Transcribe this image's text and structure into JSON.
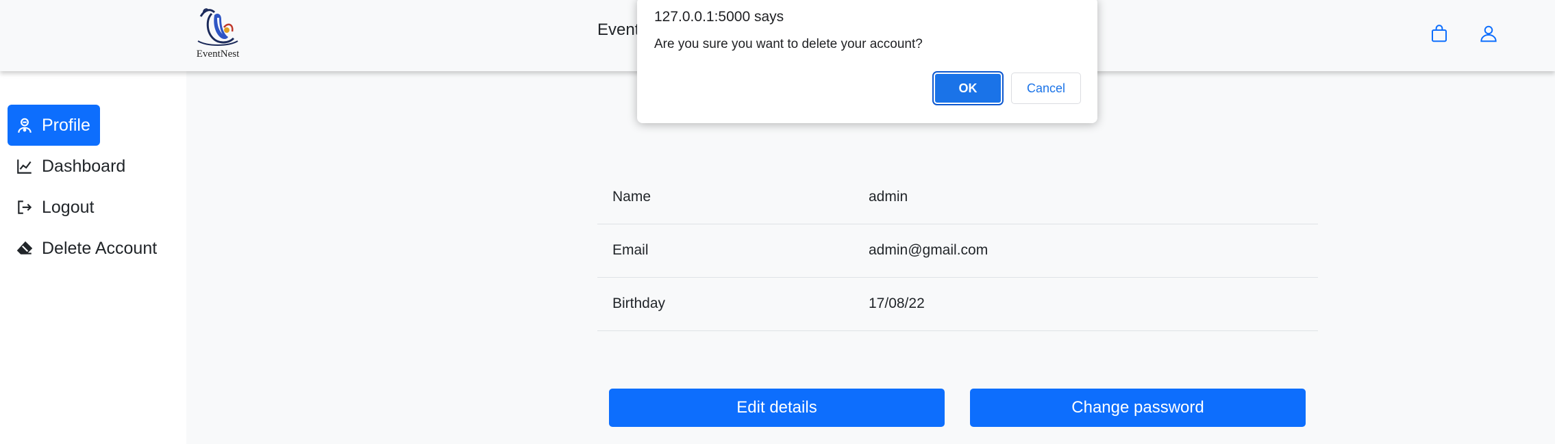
{
  "header": {
    "logo_text": "EventNest",
    "brand_partial": "Event",
    "icons": [
      "shopping-bag-icon",
      "user-icon"
    ]
  },
  "sidebar": {
    "items": [
      {
        "label": "Profile",
        "icon": "profile-icon",
        "active": true
      },
      {
        "label": "Dashboard",
        "icon": "chart-line-icon",
        "active": false
      },
      {
        "label": "Logout",
        "icon": "logout-icon",
        "active": false
      },
      {
        "label": "Delete Account",
        "icon": "eraser-icon",
        "active": false
      }
    ]
  },
  "profile": {
    "rows": [
      {
        "label": "Name",
        "value": "admin"
      },
      {
        "label": "Email",
        "value": "admin@gmail.com"
      },
      {
        "label": "Birthday",
        "value": "17/08/22"
      }
    ],
    "edit_label": "Edit details",
    "change_password_label": "Change password"
  },
  "dialog": {
    "title": "127.0.0.1:5000 says",
    "message": "Are you sure you want to delete your account?",
    "ok_label": "OK",
    "cancel_label": "Cancel"
  },
  "colors": {
    "accent": "#0d6efd",
    "dialog_accent": "#1a73e8",
    "background": "#f8f9fa"
  }
}
